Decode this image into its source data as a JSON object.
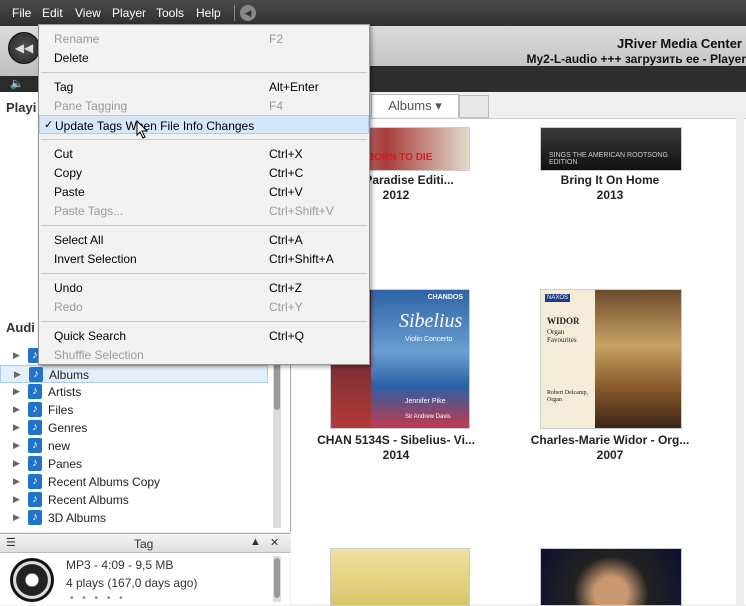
{
  "menubar": {
    "items": [
      "File",
      "Edit",
      "View",
      "Player",
      "Tools",
      "Help"
    ]
  },
  "player": {
    "title": "JRiver Media Center",
    "now_playing": "My2-L-audio +++ загрузить ее - Player"
  },
  "left": {
    "playing_header": "Playi",
    "audio_header": "Audi",
    "tree": [
      {
        "label": "Albums Copy (Album Artist)"
      },
      {
        "label": "Albums",
        "selected": true
      },
      {
        "label": "Artists"
      },
      {
        "label": "Files"
      },
      {
        "label": "Genres"
      },
      {
        "label": "new"
      },
      {
        "label": "Panes"
      },
      {
        "label": "Recent Albums Copy"
      },
      {
        "label": "Recent Albums"
      },
      {
        "label": "3D Albums"
      }
    ]
  },
  "tagpane": {
    "title": "Tag",
    "line1": "MP3 - 4:09 - 9,5 MB",
    "line2": "4 plays (167,0 days ago)",
    "dots": "• • • • •"
  },
  "content": {
    "tab": "Albums ▾",
    "albums": [
      {
        "title": "Die (Paradise Editi...",
        "year": "2012",
        "cover_text": "BORN TO DIE"
      },
      {
        "title": "Bring It On Home",
        "year": "2013",
        "cover_text": "SINGS THE AMERICAN ROOTSONG EDITION"
      },
      {
        "title": "CHAN 5134S - Sibelius- Vi...",
        "year": "2014",
        "cover_text": "Sibelius",
        "cover_sub": "Violin Concerto",
        "cover_brand": "CHANDOS",
        "cover_artist": "Jennifer Pike",
        "cover_cond": "Sir Andrew Davis"
      },
      {
        "title": "Charles-Marie Widor -  Org...",
        "year": "2007",
        "cover_text": "WIDOR",
        "cover_sub": "Organ Favourites",
        "cover_brand": "NAXOS",
        "cover_artist": "Robert Delcamp, Organ"
      }
    ]
  },
  "editmenu": {
    "items": [
      {
        "label": "Rename",
        "shortcut": "F2",
        "disabled": true
      },
      {
        "label": "Delete",
        "shortcut": "",
        "disabled": false
      },
      {
        "label": "Tag",
        "shortcut": "Alt+Enter",
        "disabled": false
      },
      {
        "label": "Pane Tagging",
        "shortcut": "F4",
        "disabled": true
      },
      {
        "label": "Update Tags When File Info Changes",
        "shortcut": "",
        "disabled": false,
        "checked": true,
        "highlighted": true
      },
      {
        "label": "Cut",
        "shortcut": "Ctrl+X",
        "disabled": false
      },
      {
        "label": "Copy",
        "shortcut": "Ctrl+C",
        "disabled": false
      },
      {
        "label": "Paste",
        "shortcut": "Ctrl+V",
        "disabled": false
      },
      {
        "label": "Paste Tags...",
        "shortcut": "Ctrl+Shift+V",
        "disabled": true
      },
      {
        "label": "Select All",
        "shortcut": "Ctrl+A",
        "disabled": false
      },
      {
        "label": "Invert Selection",
        "shortcut": "Ctrl+Shift+A",
        "disabled": false
      },
      {
        "label": "Undo",
        "shortcut": "Ctrl+Z",
        "disabled": false
      },
      {
        "label": "Redo",
        "shortcut": "Ctrl+Y",
        "disabled": true
      },
      {
        "label": "Quick Search",
        "shortcut": "Ctrl+Q",
        "disabled": false
      },
      {
        "label": "Shuffle Selection",
        "shortcut": "",
        "disabled": true
      }
    ],
    "check": "✓"
  }
}
